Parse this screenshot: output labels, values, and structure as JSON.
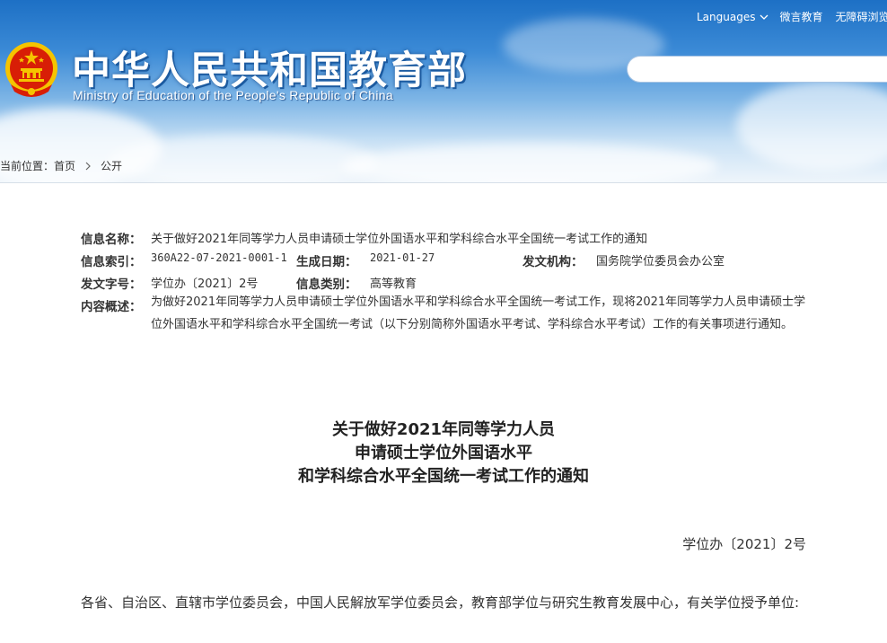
{
  "header": {
    "title_cn": "中华人民共和国教育部",
    "title_en": "Ministry of Education of the People's Republic of China",
    "languages_label": "Languages",
    "weibo_label": "微言教育",
    "accessibility_label": "无障碍浏览",
    "search_placeholder": ""
  },
  "breadcrumb": {
    "prefix": "当前位置：",
    "home": "首页",
    "current": "公开"
  },
  "info": {
    "name_label": "信息名称：",
    "name_value": "关于做好2021年同等学力人员申请硕士学位外国语水平和学科综合水平全国统一考试工作的通知",
    "index_label": "信息索引：",
    "index_value": "360A22-07-2021-0001-1",
    "date_label": "生成日期：",
    "date_value": "2021-01-27",
    "org_label": "发文机构：",
    "org_value": "国务院学位委员会办公室",
    "docno_label": "发文字号：",
    "docno_value": "学位办〔2021〕2号",
    "category_label": "信息类别：",
    "category_value": "高等教育",
    "summary_label": "内容概述：",
    "summary_value": "为做好2021年同等学力人员申请硕士学位外国语水平和学科综合水平全国统一考试工作，现将2021年同等学力人员申请硕士学位外国语水平和学科综合水平全国统一考试（以下分别简称外国语水平考试、学科综合水平考试）工作的有关事项进行通知。"
  },
  "article": {
    "title_line1": "关于做好2021年同等学力人员",
    "title_line2": "申请硕士学位外国语水平",
    "title_line3": "和学科综合水平全国统一考试工作的通知",
    "doc_no": "学位办〔2021〕2号",
    "salutation": "各省、自治区、直辖市学位委员会，中国人民解放军学位委员会，教育部学位与研究生教育发展中心，有关学位授予单位:"
  },
  "colors": {
    "header_blue": "#1d70c5",
    "emblem_red": "#d81e06",
    "emblem_gold": "#f5c400"
  }
}
